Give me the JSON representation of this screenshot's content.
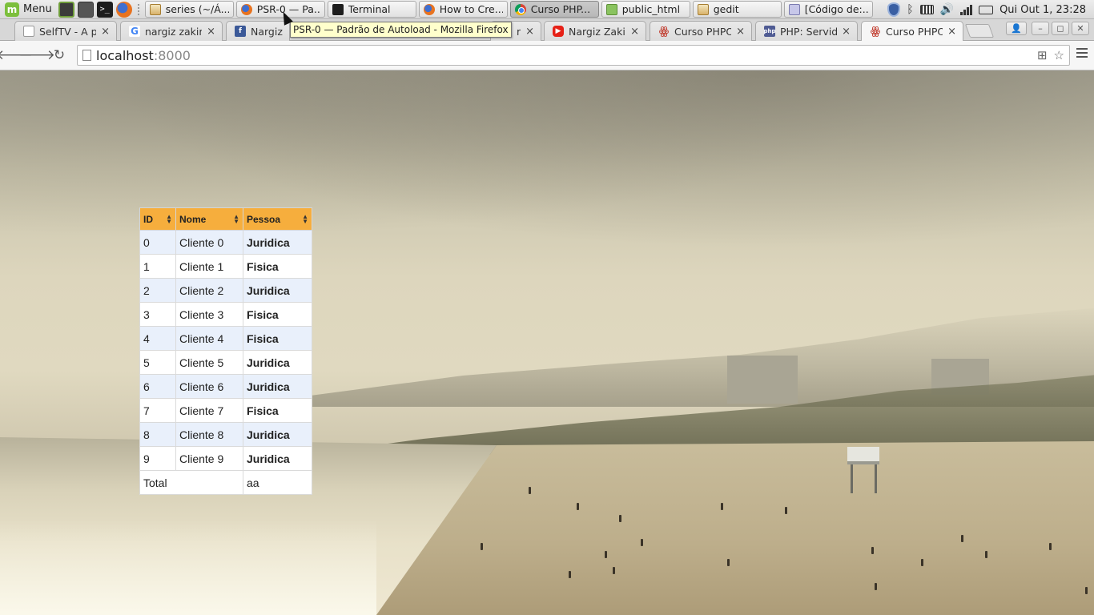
{
  "panel": {
    "menu_label": "Menu",
    "tasks": [
      {
        "label": "series (~/Á...",
        "icon": "gedit-icon",
        "active": false
      },
      {
        "label": "PSR-0 — Pa...",
        "icon": "firefox-icon",
        "active": false
      },
      {
        "label": "Terminal",
        "icon": "terminal-icon",
        "active": false
      },
      {
        "label": "How to Cre...",
        "icon": "firefox-icon",
        "active": false
      },
      {
        "label": "Curso PHP...",
        "icon": "chrome-icon",
        "active": true
      },
      {
        "label": "public_html",
        "icon": "folder-icon",
        "active": false
      },
      {
        "label": "gedit",
        "icon": "gedit-icon",
        "active": false
      },
      {
        "label": "[Código de:...",
        "icon": "code-icon",
        "active": false
      }
    ],
    "clock": "Qui Out  1, 23:28"
  },
  "tooltip": "PSR-0 — Padrão de Autoload - Mozilla Firefox",
  "tabs": [
    {
      "title": "SelfTV - A prin",
      "icon": "document-icon",
      "active": false
    },
    {
      "title": "nargiz zakirov",
      "icon": "google-icon",
      "active": false
    },
    {
      "title": "Nargiz Za",
      "icon": "facebook-icon",
      "active": false
    },
    {
      "title": "ream",
      "icon": "",
      "active": false
    },
    {
      "title": "Nargiz Zakirov",
      "icon": "youtube-icon",
      "active": false
    },
    {
      "title": "Curso PHPOO",
      "icon": "cat-icon",
      "active": false
    },
    {
      "title": "PHP: Servidor",
      "icon": "php-icon",
      "active": false
    },
    {
      "title": "Curso PHPOO",
      "icon": "cat-icon",
      "active": true
    }
  ],
  "tab_close_glyph": "×",
  "toolbar": {
    "url_host": "localhost",
    "url_port": ":8000"
  },
  "table": {
    "headers": [
      "ID",
      "Nome",
      "Pessoa"
    ],
    "rows": [
      {
        "id": "0",
        "nome": "Cliente 0",
        "pessoa": "Juridica"
      },
      {
        "id": "1",
        "nome": "Cliente 1",
        "pessoa": "Fisica"
      },
      {
        "id": "2",
        "nome": "Cliente 2",
        "pessoa": "Juridica"
      },
      {
        "id": "3",
        "nome": "Cliente 3",
        "pessoa": "Fisica"
      },
      {
        "id": "4",
        "nome": "Cliente 4",
        "pessoa": "Fisica"
      },
      {
        "id": "5",
        "nome": "Cliente 5",
        "pessoa": "Juridica"
      },
      {
        "id": "6",
        "nome": "Cliente 6",
        "pessoa": "Juridica"
      },
      {
        "id": "7",
        "nome": "Cliente 7",
        "pessoa": "Fisica"
      },
      {
        "id": "8",
        "nome": "Cliente 8",
        "pessoa": "Juridica"
      },
      {
        "id": "9",
        "nome": "Cliente 9",
        "pessoa": "Juridica"
      }
    ],
    "total_label": "Total",
    "total_value": "aa",
    "header_color": "#f6ae3d",
    "stripe_color": "#e9f0fb"
  }
}
